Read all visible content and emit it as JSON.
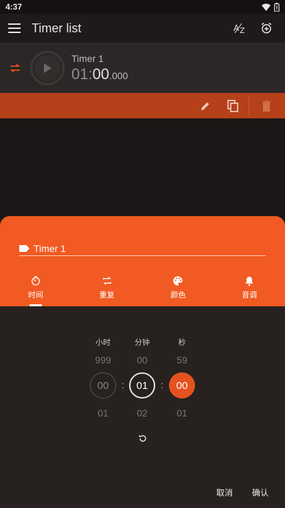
{
  "status_bar": {
    "time": "4:37"
  },
  "app_bar": {
    "title": "Timer list",
    "menu_icon": "menu-icon",
    "sort_icon": "sort-az-icon",
    "alarm_icon": "alarm-add-icon"
  },
  "timer": {
    "name": "Timer 1",
    "hours_minutes": "01:",
    "seconds": "00",
    "millis": ".000"
  },
  "sheet": {
    "name_value": "Timer 1",
    "tabs": [
      {
        "label": "时间",
        "icon": "timer-icon",
        "active": true
      },
      {
        "label": "重复",
        "icon": "repeat-icon",
        "active": false
      },
      {
        "label": "颜色",
        "icon": "palette-icon",
        "active": false
      },
      {
        "label": "音调",
        "icon": "bell-icon",
        "active": false
      }
    ],
    "picker": {
      "hours": {
        "label": "小时",
        "prev": "999",
        "current": "00",
        "next": "01"
      },
      "minutes": {
        "label": "分钟",
        "prev": "00",
        "current": "01",
        "next": "02"
      },
      "seconds": {
        "label": "秒",
        "prev": "59",
        "current": "00",
        "next": "01"
      },
      "separator": ":"
    },
    "cancel_label": "取消",
    "confirm_label": "确认"
  },
  "colors": {
    "accent": "#f15a22",
    "strip": "#b5401a",
    "background": "#1b1716"
  }
}
